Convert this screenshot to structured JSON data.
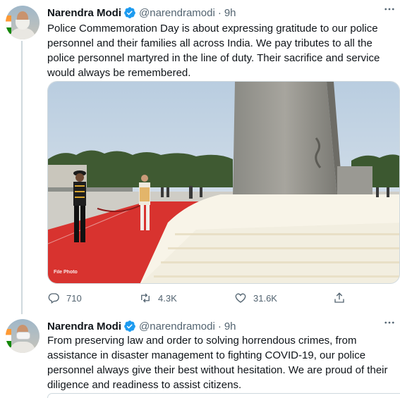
{
  "tweets": [
    {
      "author_name": "Narendra Modi",
      "handle": "@narendramodi",
      "separator": "·",
      "time": "9h",
      "text": "Police Commemoration Day is  about expressing gratitude to our police personnel and their families all across India. We pay tributes to all the police personnel martyred in the line of duty. Their sacrifice and service would always be remembered.",
      "media": {
        "watermark": "File Photo"
      },
      "actions": {
        "reply_count": "710",
        "retweet_count": "4.3K",
        "like_count": "31.6K"
      }
    },
    {
      "author_name": "Narendra Modi",
      "handle": "@narendramodi",
      "separator": "·",
      "time": "9h",
      "text": "From preserving law and order to solving horrendous crimes, from assistance in disaster management to fighting COVID-19, our police personnel always give their best without hesitation. We are proud of their diligence and readiness to assist citizens."
    }
  ],
  "colors": {
    "text": "#0f1419",
    "secondary": "#536471",
    "verified": "#1d9bf0",
    "border": "#cfd9de"
  },
  "icons": [
    "verified-badge-icon",
    "more-icon",
    "reply-icon",
    "retweet-icon",
    "like-icon",
    "share-icon"
  ]
}
